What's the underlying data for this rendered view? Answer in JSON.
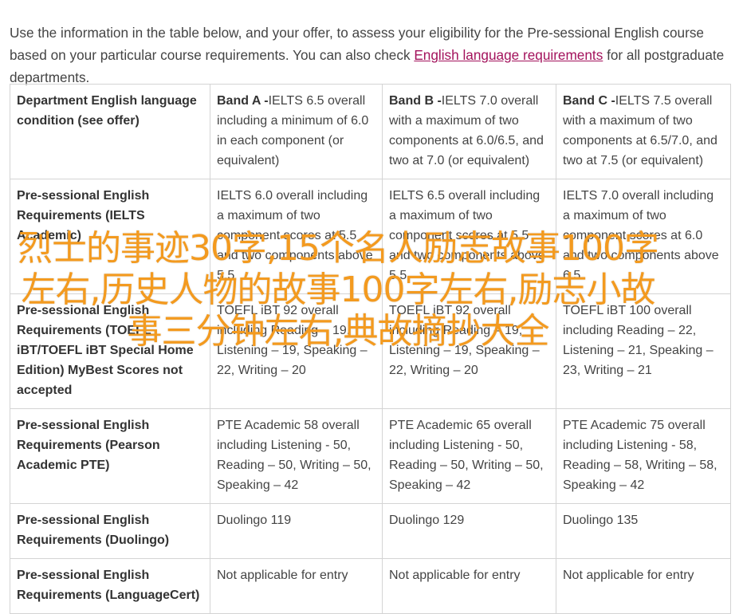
{
  "intro": {
    "text_before": "Use the information in the table below, and your offer, to assess your eligibility for the Pre-sessional English course based on your particular course requirements. You can also check ",
    "link_text": "English language requirements",
    "text_after": " for all postgraduate departments."
  },
  "table": {
    "rows": [
      {
        "label": "Department English language condition (see offer)",
        "cells": [
          {
            "bold": "Band A -",
            "text": "IELTS 6.5 overall including a minimum of 6.0 in each component (or equivalent)"
          },
          {
            "bold": "Band B -",
            "text": "IELTS 7.0 overall with a maximum of two components at 6.0/6.5, and two at 7.0 (or equivalent)"
          },
          {
            "bold": "Band C -",
            "text": "IELTS 7.5 overall with a maximum of two components at 6.5/7.0, and two at 7.5 (or equivalent)"
          }
        ]
      },
      {
        "label": "Pre-sessional English Requirements (IELTS Academic)",
        "cells": [
          {
            "bold": "",
            "text": "IELTS 6.0 overall including a maximum of two component scores at 5.5 and two components above 5.5"
          },
          {
            "bold": "",
            "text": "IELTS 6.5 overall including a maximum of two component scores at 5.5 and two components above 5.5"
          },
          {
            "bold": "",
            "text": "IELTS 7.0 overall including a maximum of two component scores at 6.0 and two components above 6.5"
          }
        ]
      },
      {
        "label": "Pre-sessional English Requirements (TOEFL iBT/TOEFL iBT Special Home Edition) MyBest Scores not accepted",
        "cells": [
          {
            "bold": "",
            "text": "TOEFL iBT 92 overall including Reading – 19, Listening – 19, Speaking – 22, Writing – 20"
          },
          {
            "bold": "",
            "text": "TOEFL iBT 92 overall including Reading – 19, Listening – 19, Speaking – 22, Writing – 20"
          },
          {
            "bold": "",
            "text": "TOEFL iBT 100 overall including Reading – 22, Listening – 21, Speaking – 23, Writing – 21"
          }
        ]
      },
      {
        "label": "Pre-sessional English Requirements (Pearson Academic PTE)",
        "cells": [
          {
            "bold": "",
            "text": "PTE Academic 58 overall including Listening - 50, Reading – 50, Writing – 50, Speaking – 42"
          },
          {
            "bold": "",
            "text": "PTE Academic 65 overall including Listening - 50, Reading – 50, Writing – 50, Speaking – 42"
          },
          {
            "bold": "",
            "text": "PTE Academic 75 overall including Listening - 58, Reading – 58, Writing – 58, Speaking – 42"
          }
        ]
      },
      {
        "label": "Pre-sessional English Requirements (Duolingo)",
        "cells": [
          {
            "bold": "",
            "text": "Duolingo 119"
          },
          {
            "bold": "",
            "text": "Duolingo 129"
          },
          {
            "bold": "",
            "text": "Duolingo 135"
          }
        ]
      },
      {
        "label": "Pre-sessional English Requirements (LanguageCert)",
        "cells": [
          {
            "bold": "",
            "text": "Not applicable for entry"
          },
          {
            "bold": "",
            "text": "Not applicable for entry"
          },
          {
            "bold": "",
            "text": "Not applicable for entry"
          }
        ]
      }
    ]
  },
  "overlay": {
    "text": "烈士的事迹30字,15个名人励志故事100字左右,历史人物的故事100字左右,励志小故事三分钟左右,典故摘抄大全",
    "color": "#f39a1f"
  },
  "colors": {
    "link": "#a3125c",
    "border": "#d4d4d4",
    "text": "#444444"
  }
}
